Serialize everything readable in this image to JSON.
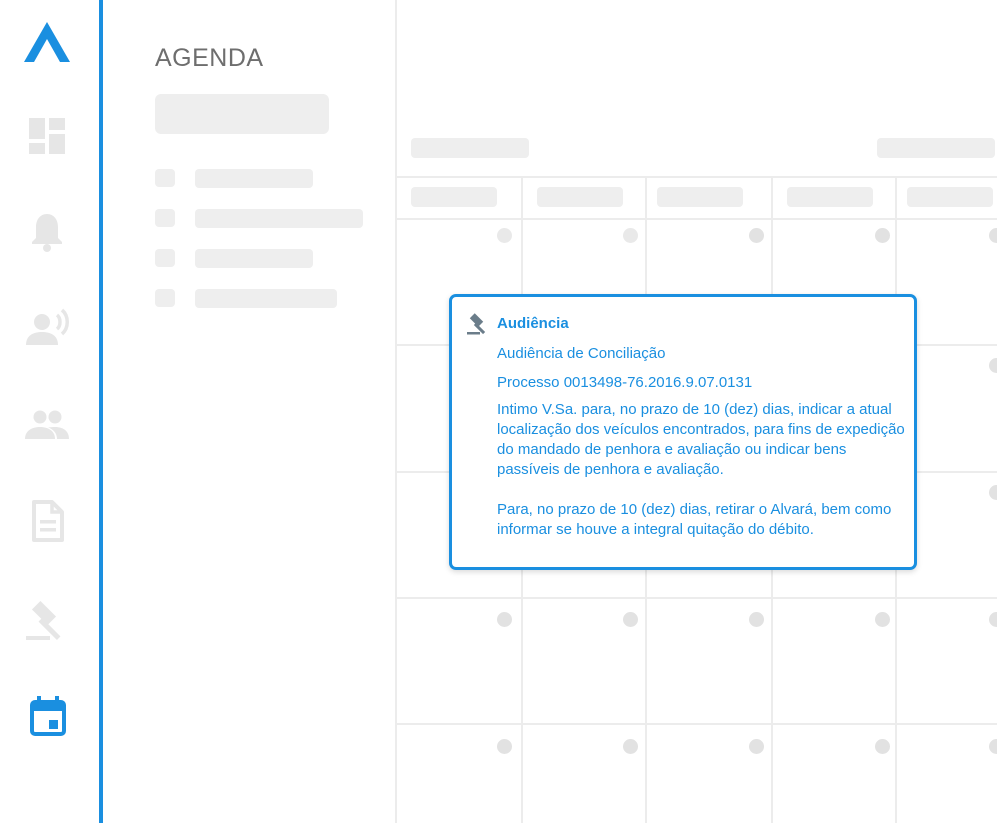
{
  "sidebar": {
    "logo": "app-logo",
    "items": [
      {
        "name": "dashboard",
        "icon": "dashboard-icon",
        "active": false
      },
      {
        "name": "notifications",
        "icon": "bell-icon",
        "active": false
      },
      {
        "name": "clients",
        "icon": "person-voice-icon",
        "active": false
      },
      {
        "name": "team",
        "icon": "people-icon",
        "active": false
      },
      {
        "name": "documents",
        "icon": "document-icon",
        "active": false
      },
      {
        "name": "processes",
        "icon": "gavel-icon",
        "active": false
      },
      {
        "name": "agenda",
        "icon": "calendar-icon",
        "active": true
      }
    ],
    "accent_color": "#1a8fe0",
    "inactive_color": "#e6e6e6"
  },
  "panel": {
    "title": "AGENDA"
  },
  "popup": {
    "icon": "gavel-icon",
    "title": "Audiência",
    "subtitle": "Audiência de Conciliação",
    "process": "Processo 0013498-76.2016.9.07.0131",
    "paragraph1": "Intimo V.Sa. para, no prazo de 10 (dez) dias, indicar a atual localização dos veículos encontrados, para fins de expedição do mandado de penhora e avaliação ou indicar bens passíveis de penhora e avaliação.",
    "paragraph2": "Para, no prazo de 10 (dez) dias, retirar o Alvará, bem como informar se houve a integral quitação do débito.",
    "color": "#1a8fe0"
  }
}
